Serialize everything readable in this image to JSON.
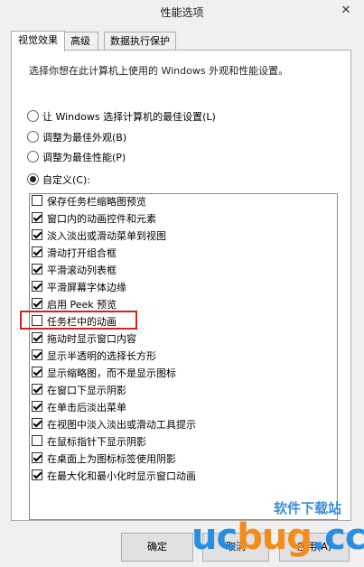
{
  "window": {
    "title": "性能选项",
    "close": "✕"
  },
  "tabs": [
    {
      "label": "视觉效果",
      "active": true
    },
    {
      "label": "高级",
      "active": false
    },
    {
      "label": "数据执行保护",
      "active": false
    }
  ],
  "description": "选择你想在此计算机上使用的 Windows 外观和性能设置。",
  "radios": [
    {
      "label": "让 Windows 选择计算机的最佳设置(L)",
      "selected": false
    },
    {
      "label": "调整为最佳外观(B)",
      "selected": false
    },
    {
      "label": "调整为最佳性能(P)",
      "selected": false
    },
    {
      "label": "自定义(C):",
      "selected": true
    }
  ],
  "options": [
    {
      "label": "保存任务栏缩略图预览",
      "checked": false
    },
    {
      "label": "窗口内的动画控件和元素",
      "checked": true
    },
    {
      "label": "淡入淡出或滑动菜单到视图",
      "checked": true
    },
    {
      "label": "滑动打开组合框",
      "checked": true
    },
    {
      "label": "平滑滚动列表框",
      "checked": true
    },
    {
      "label": "平滑屏幕字体边缘",
      "checked": true
    },
    {
      "label": "启用 Peek 预览",
      "checked": true
    },
    {
      "label": "任务栏中的动画",
      "checked": false
    },
    {
      "label": "拖动时显示窗口内容",
      "checked": true
    },
    {
      "label": "显示半透明的选择长方形",
      "checked": true
    },
    {
      "label": "显示缩略图，而不是显示图标",
      "checked": true
    },
    {
      "label": "在窗口下显示阴影",
      "checked": true
    },
    {
      "label": "在单击后淡出菜单",
      "checked": true
    },
    {
      "label": "在视图中淡入淡出或滑动工具提示",
      "checked": true
    },
    {
      "label": "在鼠标指针下显示阴影",
      "checked": false
    },
    {
      "label": "在桌面上为图标标签使用阴影",
      "checked": true
    },
    {
      "label": "在最大化和最小化时显示窗口动画",
      "checked": true
    }
  ],
  "buttons": {
    "ok": "确定",
    "cancel": "取消",
    "apply": "应用(A)"
  },
  "watermark": {
    "text": "软件下载站",
    "logo_a": "uc",
    "logo_b": "bug",
    "logo_c": ".cc"
  }
}
